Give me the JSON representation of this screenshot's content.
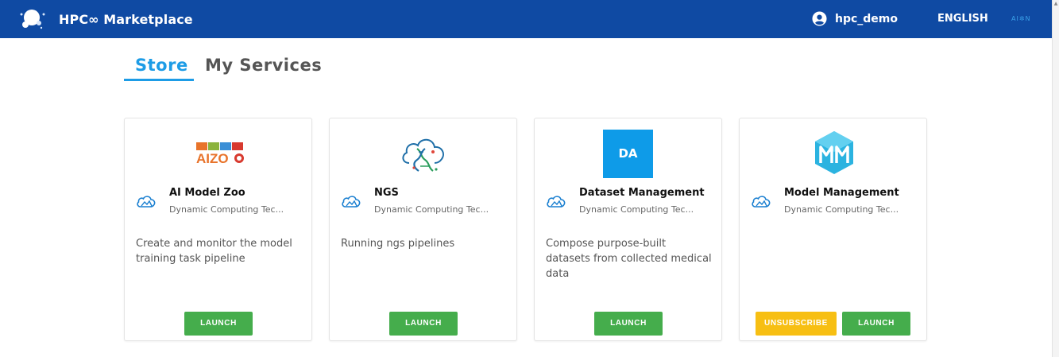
{
  "header": {
    "title": "HPC∞ Marketplace",
    "user": "hpc_demo",
    "language": "ENGLISH",
    "partner": "AI✲N",
    "bar_color": "#0f4aa3"
  },
  "tabs": [
    {
      "label": "Store",
      "active": true
    },
    {
      "label": "My Services",
      "active": false
    }
  ],
  "cards": [
    {
      "title": "AI Model Zoo",
      "vendor": "Dynamic Computing Tec...",
      "description": "Create and monitor the model training task pipeline",
      "logo_text": "AIZO",
      "launch_label": "LAUNCH"
    },
    {
      "title": "NGS",
      "vendor": "Dynamic Computing Tec...",
      "description": "Running ngs pipelines",
      "launch_label": "LAUNCH"
    },
    {
      "title": "Dataset Management",
      "vendor": "Dynamic Computing Tec...",
      "description": "Compose purpose-built datasets from collected medical data",
      "logo_text": "DA",
      "launch_label": "LAUNCH"
    },
    {
      "title": "Model Management",
      "vendor": "Dynamic Computing Tec...",
      "description": "",
      "unsubscribe_label": "UNSUBSCRIBE",
      "launch_label": "LAUNCH"
    }
  ],
  "colors": {
    "accent": "#1d9ce6",
    "launch": "#45ad4c",
    "unsubscribe": "#f7bf13"
  }
}
